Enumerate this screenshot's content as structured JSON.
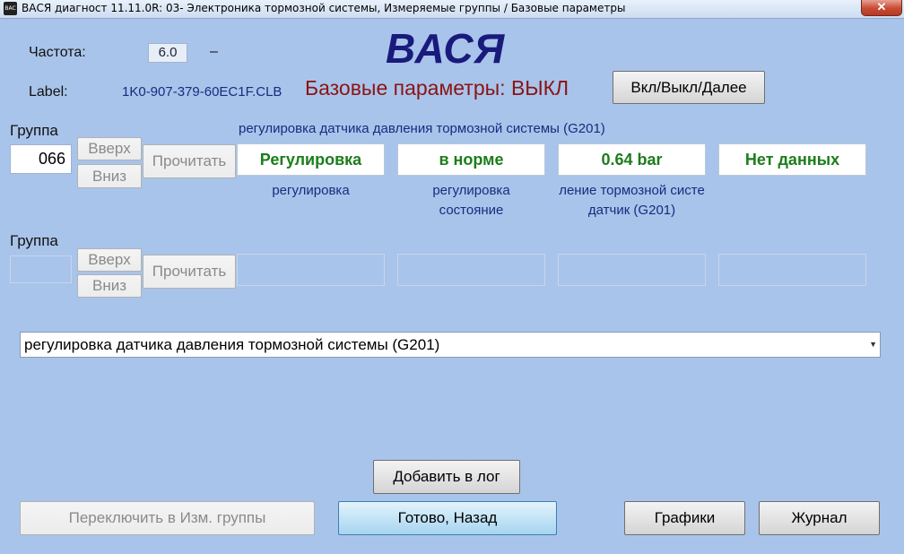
{
  "window": {
    "title": "ВАСЯ диагност 11.11.0R: 03- Электроника тормозной системы,  Измеряемые группы / Базовые параметры",
    "icon_text": "BAC",
    "close_glyph": "✕"
  },
  "header": {
    "logo": "ВАСЯ",
    "freq_label": "Частота:",
    "freq_value": "6.0",
    "freq_dash": "–",
    "label_caption": "Label:",
    "label_value": "1K0-907-379-60EC1F.CLB",
    "basic_status": "Базовые параметры: ВЫКЛ",
    "toggle_button": "Вкл/Выкл/Далее"
  },
  "group1": {
    "caption": "Группа",
    "number": "066",
    "up": "Вверх",
    "down": "Вниз",
    "read": "Прочитать",
    "title": "регулировка датчика давления тормозной системы (G201)",
    "fields": [
      "Регулировка",
      "в норме",
      "0.64 bar",
      "Нет данных"
    ],
    "sublabels": [
      [
        "регулировка",
        ""
      ],
      [
        "регулировка",
        "состояние"
      ],
      [
        "ление тормозной систе",
        "датчик (G201)"
      ],
      [
        "",
        ""
      ]
    ]
  },
  "group2": {
    "caption": "Группа",
    "number": "",
    "up": "Вверх",
    "down": "Вниз",
    "read": "Прочитать"
  },
  "combo": {
    "selected": "регулировка датчика давления тормозной системы (G201)",
    "arrow": "▼"
  },
  "footer": {
    "add_log": "Добавить в лог",
    "switch_groups": "Переключить в Изм. группы",
    "done_back": "Готово, Назад",
    "graphs": "Графики",
    "journal": "Журнал"
  }
}
